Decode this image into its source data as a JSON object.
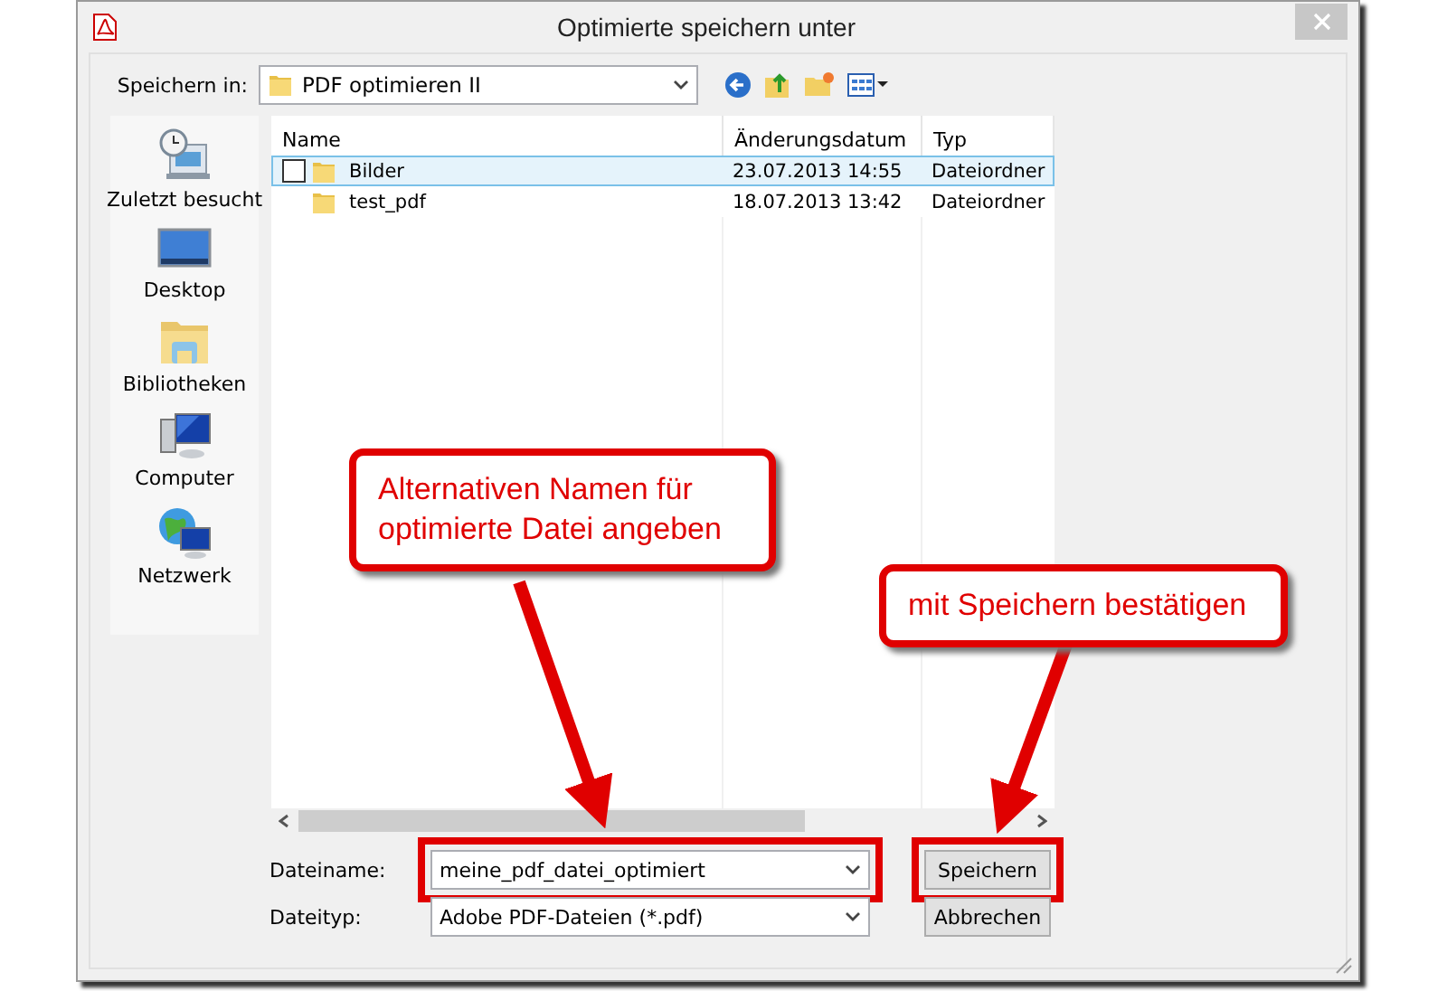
{
  "window": {
    "title": "Optimierte speichern unter"
  },
  "location": {
    "label": "Speichern in:",
    "value": "PDF optimieren II"
  },
  "places": [
    {
      "label": "Zuletzt besucht",
      "kind": "recent"
    },
    {
      "label": "Desktop",
      "kind": "desktop"
    },
    {
      "label": "Bibliotheken",
      "kind": "library"
    },
    {
      "label": "Computer",
      "kind": "computer"
    },
    {
      "label": "Netzwerk",
      "kind": "network"
    }
  ],
  "file_list": {
    "columns": [
      "Name",
      "Änderungsdatum",
      "Typ"
    ],
    "rows": [
      {
        "name": "Bilder",
        "date": "23.07.2013 14:55",
        "type": "Dateiordner",
        "selected": true
      },
      {
        "name": "test_pdf",
        "date": "18.07.2013 13:42",
        "type": "Dateiordner",
        "selected": false
      }
    ]
  },
  "filename": {
    "label": "Dateiname:",
    "value": "meine_pdf_datei_optimiert",
    "highlighted": true
  },
  "filetype": {
    "label": "Dateityp:",
    "value": "Adobe PDF-Dateien (*.pdf)"
  },
  "buttons": [
    {
      "label": "Speichern",
      "highlighted": true
    },
    {
      "label": "Abbrechen",
      "highlighted": false
    }
  ],
  "annotations": [
    {
      "text": "Alternativen Namen für optimierte Datei angeben"
    },
    {
      "text": "mit Speichern bestätigen"
    }
  ]
}
